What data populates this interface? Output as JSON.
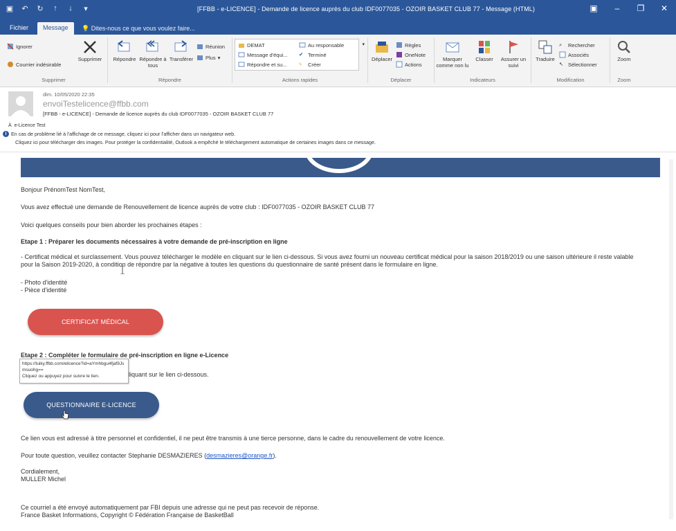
{
  "window": {
    "title": "[FFBB - e-LICENCE] - Demande de licence auprès du club IDF0077035 - OZOIR BASKET CLUB 77 - Message (HTML)"
  },
  "tabs": {
    "file": "Fichier",
    "message": "Message",
    "tell_me": "Dites-nous ce que vous voulez faire..."
  },
  "ribbon": {
    "delete_group": {
      "label": "Supprimer",
      "ignore": "Ignorer",
      "junk": "Courrier indésirable",
      "delete": "Supprimer"
    },
    "respond_group": {
      "label": "Répondre",
      "reply": "Répondre",
      "reply_all": "Répondre à tous",
      "forward": "Transférer",
      "meeting": "Réunion",
      "more": "Plus"
    },
    "quicksteps_group": {
      "label": "Actions rapides",
      "items": [
        "DEMAT",
        "Message d'équi...",
        "Répondre et su...",
        "Au responsable",
        "Terminé",
        "Créer"
      ]
    },
    "move_group": {
      "label": "Déplacer",
      "move": "Déplacer",
      "rules": "Règles",
      "onenote": "OneNote",
      "actions": "Actions"
    },
    "tags_group": {
      "label": "Indicateurs",
      "mark_unread": "Marquer comme non lu",
      "categorize": "Classer",
      "follow_up": "Assurer un suivi"
    },
    "editing_group": {
      "label": "Modification",
      "translate": "Traduire",
      "find": "Rechercher",
      "related": "Associés",
      "select": "Sélectionner"
    },
    "zoom_group": {
      "label": "Zoom",
      "zoom": "Zoom"
    }
  },
  "header": {
    "date": "dim. 10/05/2020 22:35",
    "from": "envoiTestelicence@ffbb.com",
    "subject": "[FFBB - e-LICENCE] - Demande de licence auprès du club IDF0077035 - OZOIR BASKET CLUB 77",
    "to": "e-Licence Test",
    "info1": "En cas de problème lié à l'affichage de ce message, cliquez ici pour l'afficher dans un navigateur web.",
    "info2": "Cliquez ici pour télécharger des images. Pour protéger la confidentialité, Outlook a empêché le téléchargement automatique de certaines images dans ce message."
  },
  "body": {
    "greeting": "Bonjour PrénomTest NomTest,",
    "p1": "Vous avez effectué une demande de Renouvellement de licence auprès de votre club : IDF0077035 - OZOIR BASKET CLUB 77",
    "p2": "Voici quelques conseils pour bien aborder les prochaines étapes :",
    "step1_title": "Etape 1 : Préparer les documents nécessaires à votre demande de pré-inscription en ligne",
    "step1_text": "- Certificat médical et surclassement. Vous pouvez télécharger le modèle en cliquant sur le lien ci-dessous. Si vous avez fourni un nouveau certificat médical pour la saison 2018/2019 ou une saison ultérieure il reste valable pour la Saison 2019-2020, à condition de répondre par la négative à toutes les questions du questionnaire de santé présent dans le formulaire en ligne.",
    "list1": "- Photo d'identité",
    "list2": "- Pièce d'identité",
    "cert_button": "CERTIFICAT MÉDICAL",
    "step2_title": "Etape 2 : Compléter le formulaire de pré-inscription en ligne e-Licence",
    "step2_text_tail": "liquant sur le lien ci-dessous.",
    "tooltip_url": "https://tuiky.ffbb.com/elicence?id=aYmhbgu4fjaf9Jsmsuohg==",
    "tooltip_hint": "Cliquez ou appuyez pour suivre le lien.",
    "quest_button": "QUESTIONNAIRE E-LICENCE",
    "p3": "Ce lien vous est adressé à titre personnel et confidentiel, il ne peut être transmis à une tierce personne, dans le cadre du renouvellement de votre licence.",
    "p4_prefix": "Pour toute question, veuillez contacter Stephanie DESMAZIERES (",
    "p4_link": "desmazieres@orange.fr",
    "p4_suffix": ").",
    "closing": "Cordialement,",
    "signature": "MULLER Michel",
    "footer1": "Ce courriel a été envoyé automatiquement par FBI depuis une adresse qui ne peut pas recevoir de réponse.",
    "footer2": "France Basket Informations, Copyright © Fédération Française de BasketBall"
  }
}
